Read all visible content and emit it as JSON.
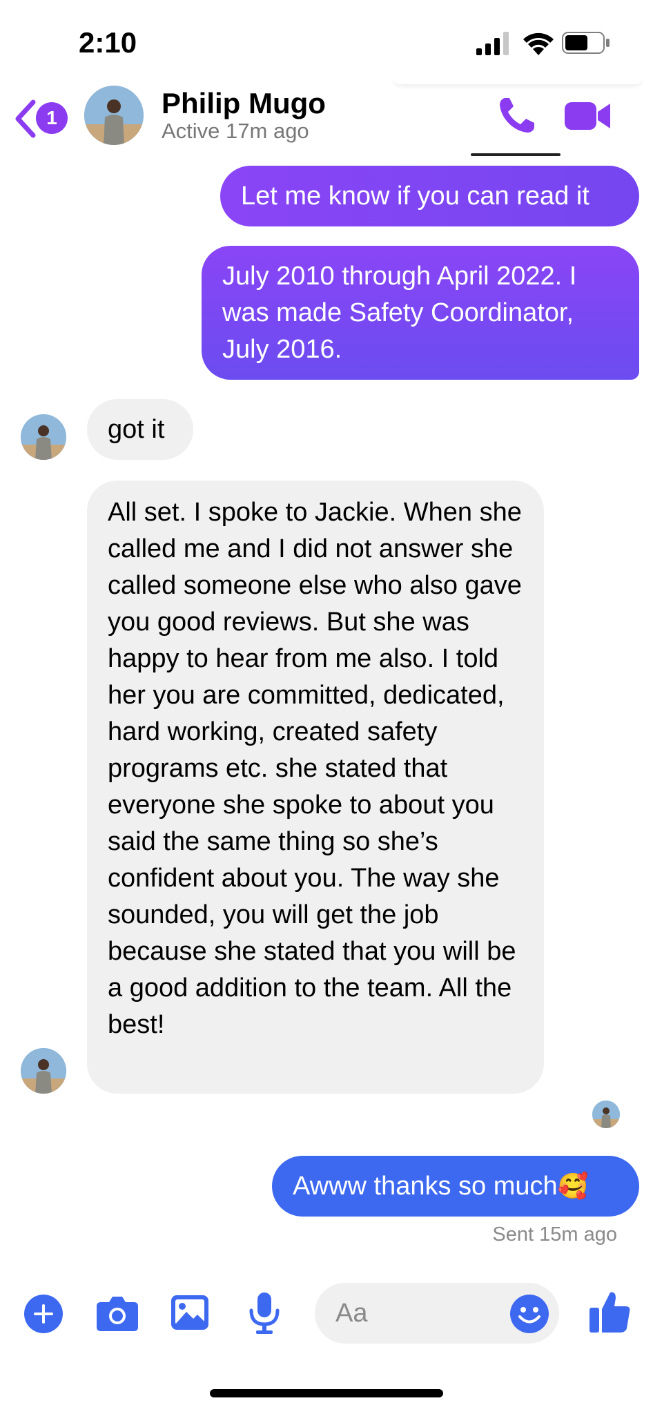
{
  "status_bar": {
    "time": "2:10"
  },
  "header": {
    "back_badge": "1",
    "contact_name": "Philip Mugo",
    "contact_status": "Active 17m ago"
  },
  "messages": [
    {
      "direction": "sent",
      "text": "Let me know if you can read it"
    },
    {
      "direction": "sent",
      "text": "July 2010 through April 2022. I was made Safety Coordinator, July 2016."
    },
    {
      "direction": "received",
      "text": "got it"
    },
    {
      "direction": "received",
      "text": "All set. I spoke to Jackie. When she called me and I did not answer she called someone else who also gave you good reviews. But she was happy to hear from me also. I told her you are committed, dedicated, hard working, created safety programs etc. she stated that everyone she spoke to about you said the same thing so she’s confident about you. The way she sounded, you will get the job because she stated that you will be a good addition to the team. All the best!"
    },
    {
      "direction": "sent",
      "text": "Awww thanks so much",
      "emoji": "🥰"
    }
  ],
  "sent_status": "Sent 15m ago",
  "composer": {
    "placeholder": "Aa"
  },
  "colors": {
    "accent": "#8b3cf1",
    "sent_bubble": "#7546f0",
    "last_sent_bubble": "#3d69f1",
    "composer_icon": "#3d69f1"
  }
}
